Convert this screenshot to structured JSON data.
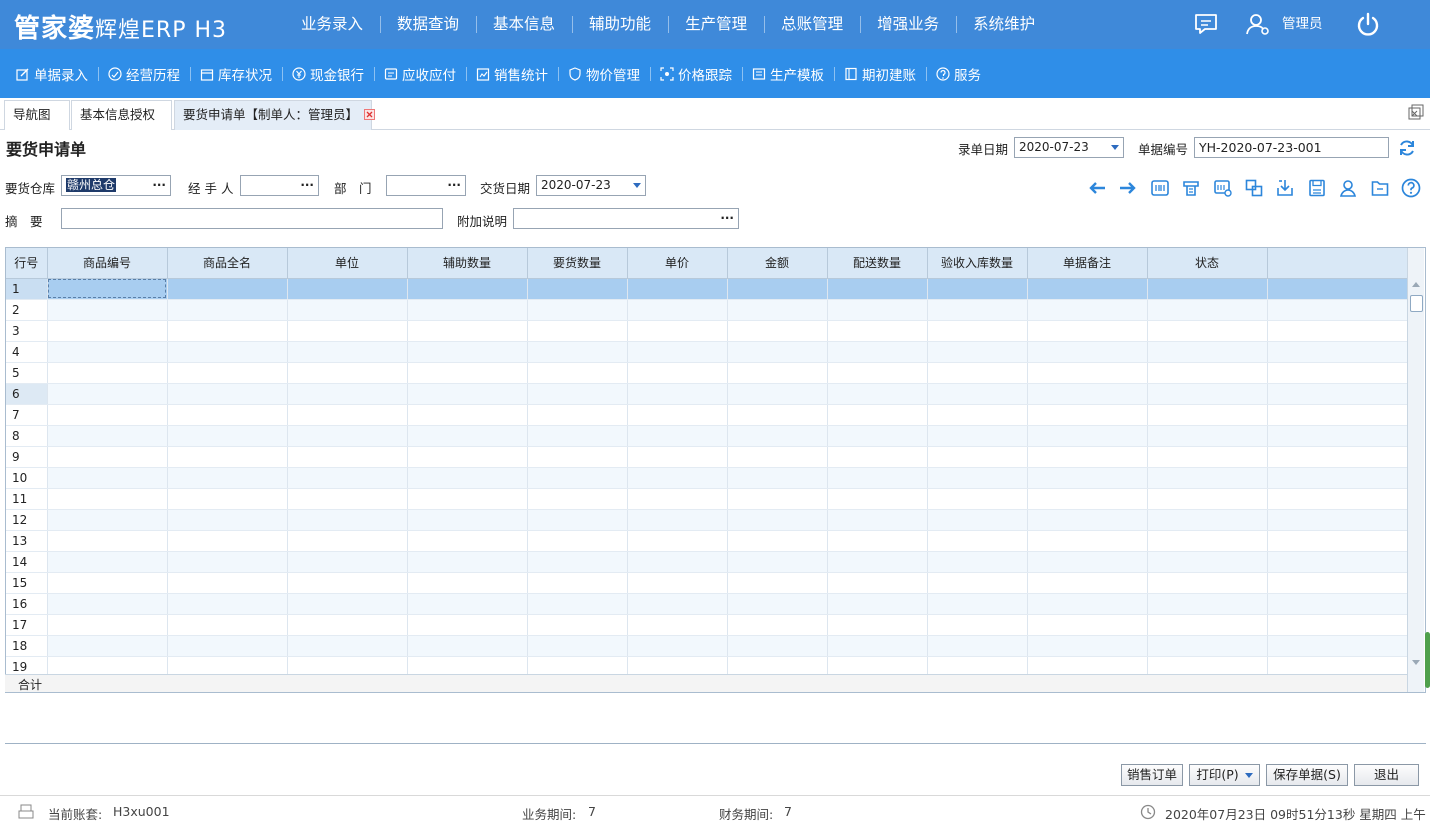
{
  "app": {
    "logo_main": "管家婆",
    "logo_sub": "辉煌ERP H3",
    "menu": [
      "业务录入",
      "数据查询",
      "基本信息",
      "辅助功能",
      "生产管理",
      "总账管理",
      "增强业务",
      "系统维护"
    ],
    "user": "管理员"
  },
  "toolbar": [
    {
      "label": "单据录入",
      "icon": "edit-icon"
    },
    {
      "label": "经营历程",
      "icon": "chart-circle-icon"
    },
    {
      "label": "库存状况",
      "icon": "box-icon"
    },
    {
      "label": "现金银行",
      "icon": "yen-icon"
    },
    {
      "label": "应收应付",
      "icon": "ledger-icon"
    },
    {
      "label": "销售统计",
      "icon": "sales-icon"
    },
    {
      "label": "物价管理",
      "icon": "shield-icon"
    },
    {
      "label": "价格跟踪",
      "icon": "tracking-icon"
    },
    {
      "label": "生产模板",
      "icon": "template-icon"
    },
    {
      "label": "期初建账",
      "icon": "book-icon"
    },
    {
      "label": "服务",
      "icon": "help-icon"
    }
  ],
  "tabs": [
    "导航图",
    "基本信息授权",
    "要货申请单【制单人：管理员】"
  ],
  "form": {
    "title": "要货申请单",
    "entry_date_label": "录单日期",
    "entry_date": "2020-07-23",
    "doc_no_label": "单据编号",
    "doc_no": "YH-2020-07-23-001",
    "warehouse_label": "要货仓库",
    "warehouse": "赣州总仓",
    "handler_label": "经 手 人",
    "handler": "",
    "dept_label": "部　门",
    "dept": "",
    "delivery_date_label": "交货日期",
    "delivery_date": "2020-07-23",
    "summary_label": "摘　要",
    "summary": "",
    "note_label": "附加说明",
    "note": ""
  },
  "action_icons": [
    "prev-arrow-icon",
    "next-arrow-icon",
    "barcode-icon",
    "printer-config-icon",
    "scan-icon",
    "copy-icon",
    "import-icon",
    "save-template-icon",
    "user-select-icon",
    "folder-icon",
    "help-circle-icon"
  ],
  "grid": {
    "columns": [
      "行号",
      "商品编号",
      "商品全名",
      "单位",
      "辅助数量",
      "要货数量",
      "单价",
      "金额",
      "配送数量",
      "验收入库数量",
      "单据备注",
      "状态"
    ],
    "rows": [
      "1",
      "2",
      "3",
      "4",
      "5",
      "6",
      "7",
      "8",
      "9",
      "10",
      "11",
      "12",
      "13",
      "14",
      "15",
      "16",
      "17",
      "18",
      "19"
    ],
    "total_label": "合计"
  },
  "buttons": {
    "sales_order": "销售订单",
    "print": "打印(P)",
    "save": "保存单据(S)",
    "exit": "退出"
  },
  "status": {
    "account_label": "当前账套:",
    "account": "H3xu001",
    "biz_period_label": "业务期间:",
    "biz_period": "7",
    "fin_period_label": "财务期间:",
    "fin_period": "7",
    "datetime": "2020年07月23日 09时51分13秒 星期四 上午"
  },
  "colors": {
    "topbar": "#3f89d9",
    "toolbar": "#2f8ee8",
    "accent": "#2d6bbf"
  }
}
